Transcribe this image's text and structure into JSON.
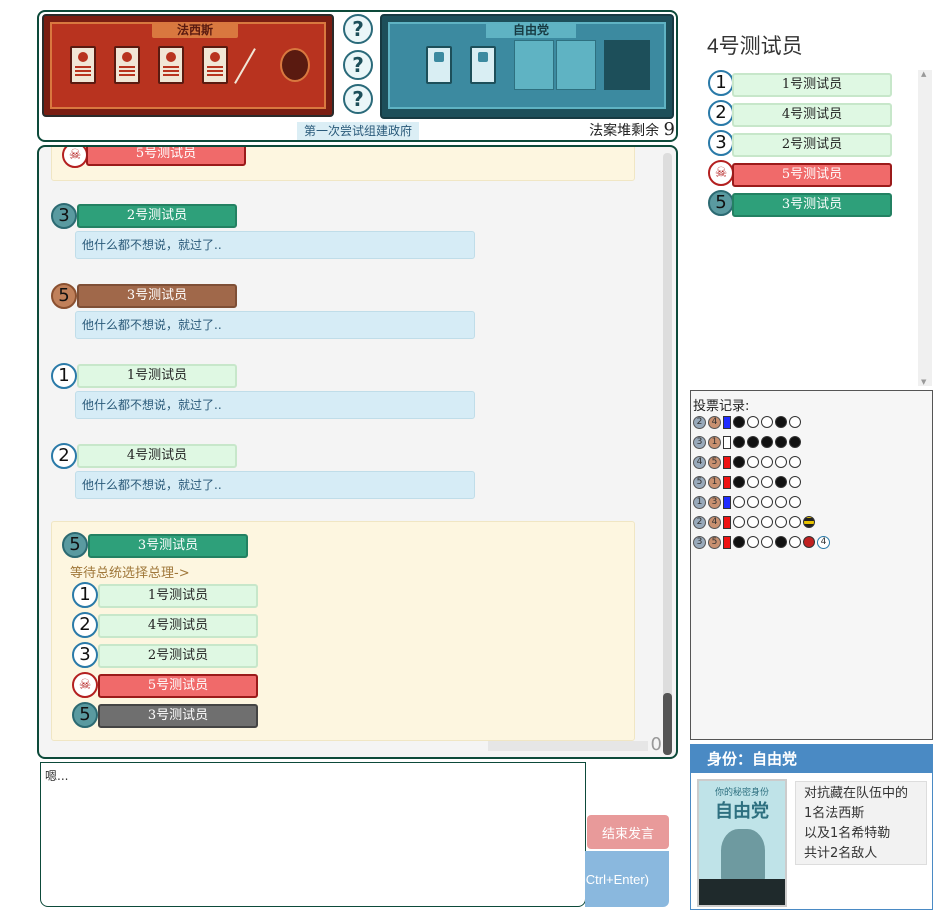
{
  "board": {
    "fascist_title": "法西斯",
    "liberal_title": "自由党",
    "caption": "第一次尝试组建政府",
    "deck_label": "法案堆剩余",
    "deck_count": "9",
    "mystery": [
      "?",
      "?",
      "?"
    ]
  },
  "chat": {
    "top_entry": {
      "name": "5号测试员"
    },
    "entries": [
      {
        "seat": "3",
        "name": "2号测试员",
        "text": "他什么都不想说，就过了.."
      },
      {
        "seat": "5",
        "name": "3号测试员",
        "text": "他什么都不想说，就过了.."
      },
      {
        "seat": "1",
        "name": "1号测试员",
        "text": "他什么都不想说，就过了.."
      },
      {
        "seat": "2",
        "name": "4号测试员",
        "text": "他什么都不想说，就过了.."
      }
    ],
    "nominate": {
      "seat": "5",
      "name": "3号测试员",
      "waiting": "等待总统选择总理->",
      "options": [
        {
          "seat": "1",
          "name": "1号测试员"
        },
        {
          "seat": "2",
          "name": "4号测试员"
        },
        {
          "seat": "3",
          "name": "2号测试员"
        },
        {
          "seat": "☠",
          "name": "5号测试员"
        },
        {
          "seat": "5",
          "name": "3号测试员"
        }
      ]
    },
    "counter": "0"
  },
  "input": {
    "value": "嗯..."
  },
  "buttons": {
    "end": "结束发言",
    "send": "Ctrl+Enter)"
  },
  "player": {
    "name": "4号测试员"
  },
  "players": [
    {
      "seat": "1",
      "name": "1号测试员",
      "status": "normal"
    },
    {
      "seat": "2",
      "name": "4号测试员",
      "status": "normal"
    },
    {
      "seat": "3",
      "name": "2号测试员",
      "status": "normal"
    },
    {
      "seat": "☠",
      "name": "5号测试员",
      "status": "dead"
    },
    {
      "seat": "5",
      "name": "3号测试员",
      "status": "president"
    }
  ],
  "votes": {
    "title": "投票记录:",
    "rows": [
      {
        "a": "2",
        "b": "4",
        "bar": "#1f2bff",
        "dots": [
          "f",
          "o",
          "o",
          "f",
          "o"
        ]
      },
      {
        "a": "3",
        "b": "1",
        "bar": "#ffffff",
        "dots": [
          "f",
          "f",
          "f",
          "f",
          "f"
        ]
      },
      {
        "a": "4",
        "b": "5",
        "bar": "#ee1111",
        "dots": [
          "f",
          "o",
          "o",
          "o",
          "o"
        ]
      },
      {
        "a": "5",
        "b": "1",
        "bar": "#ee1111",
        "dots": [
          "f",
          "o",
          "o",
          "f",
          "o"
        ]
      },
      {
        "a": "1",
        "b": "3",
        "bar": "#1f2bff",
        "dots": [
          "o",
          "o",
          "o",
          "o",
          "o"
        ]
      },
      {
        "a": "2",
        "b": "4",
        "bar": "#ee1111",
        "dots": [
          "o",
          "o",
          "o",
          "o",
          "o"
        ]
      },
      {
        "a": "3",
        "b": "5",
        "bar": "#ee1111",
        "dots": [
          "f",
          "o",
          "o",
          "f",
          "o"
        ]
      }
    ],
    "extra_4": "4"
  },
  "identity": {
    "header": "身份：自由党",
    "card_caption": "你的秘密身份",
    "card_title": "自由党",
    "text": [
      "对抗藏在队伍中的",
      "1名法西斯",
      "以及1名希特勒",
      "共计2名敌人"
    ]
  }
}
